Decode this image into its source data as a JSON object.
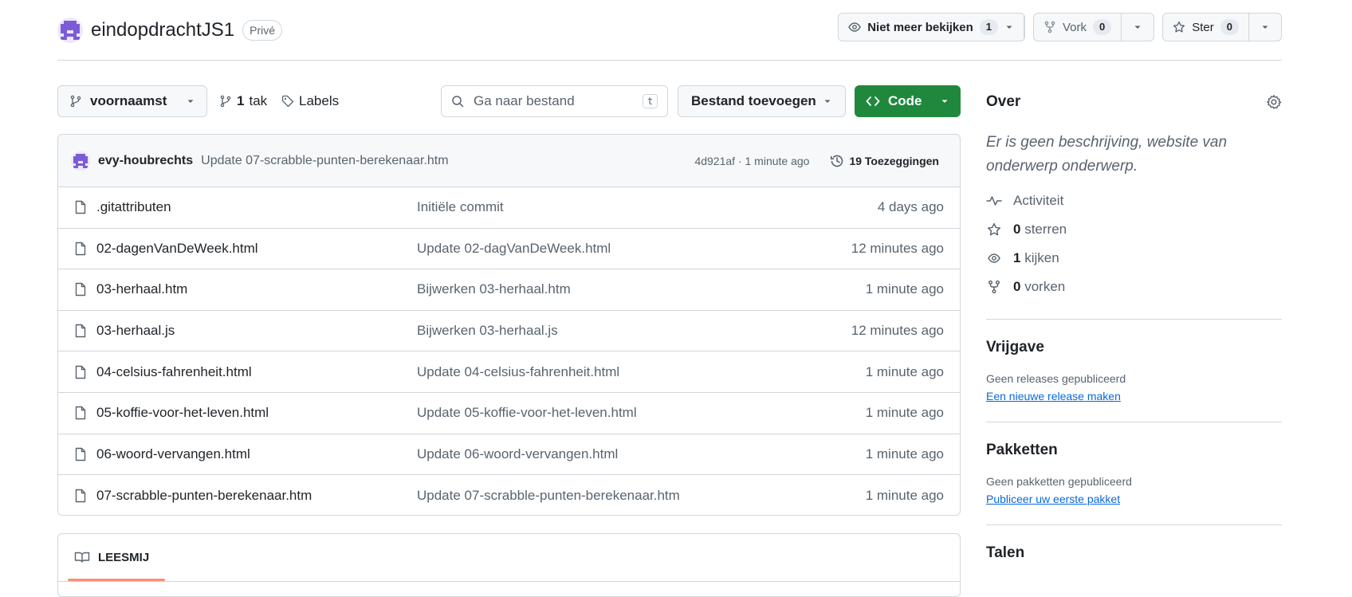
{
  "repo": {
    "name": "eindopdrachtJS1",
    "visibility": "Privé"
  },
  "header_actions": {
    "watch": {
      "label": "Niet meer bekijken",
      "count": "1"
    },
    "fork": {
      "label": "Vork",
      "count": "0"
    },
    "star": {
      "label": "Ster",
      "count": "0"
    }
  },
  "toolbar": {
    "branch": "voornaamst",
    "branches_count": "1",
    "branches_label": "tak",
    "tags_label": "Labels",
    "search_placeholder": "Ga naar bestand",
    "search_shortcut": "t",
    "add_file_label": "Bestand toevoegen",
    "code_label": "Code"
  },
  "latest_commit": {
    "author": "evy-houbrechts",
    "message": "Update 07-scrabble-punten-berekenaar.htm",
    "hash_time": "4d921af · 1 minute ago",
    "commits_label": "19 Toezeggingen"
  },
  "files": [
    {
      "name": ".gitattributen",
      "message": "Initiële commit",
      "age": "4 days ago"
    },
    {
      "name": "02-dagenVanDeWeek.html",
      "message": "Update 02-dagVanDeWeek.html",
      "age": "12 minutes ago"
    },
    {
      "name": "03-herhaal.htm",
      "message": "Bijwerken 03-herhaal.htm",
      "age": "1 minute ago"
    },
    {
      "name": "03-herhaal.js",
      "message": "Bijwerken 03-herhaal.js",
      "age": "12 minutes ago"
    },
    {
      "name": "04-celsius-fahrenheit.html",
      "message": "Update 04-celsius-fahrenheit.html",
      "age": "1 minute ago"
    },
    {
      "name": "05-koffie-voor-het-leven.html",
      "message": "Update 05-koffie-voor-het-leven.html",
      "age": "1 minute ago"
    },
    {
      "name": "06-woord-vervangen.html",
      "message": "Update 06-woord-vervangen.html",
      "age": "1 minute ago"
    },
    {
      "name": "07-scrabble-punten-berekenaar.htm",
      "message": "Update 07-scrabble-punten-berekenaar.htm",
      "age": "1 minute ago"
    }
  ],
  "readme": {
    "tab_label": "LEESMIJ"
  },
  "sidebar": {
    "about_title": "Over",
    "about_description": "Er is geen beschrijving, website van onderwerp onderwerp.",
    "activity_label": "Activiteit",
    "stars_count": "0",
    "stars_label": "sterren",
    "watchers_count": "1",
    "watchers_label": "kijken",
    "forks_count": "0",
    "forks_label": "vorken",
    "releases_title": "Vrijgave",
    "releases_empty": "Geen releases gepubliceerd",
    "releases_link": "Een nieuwe release maken",
    "packages_title": "Pakketten",
    "packages_empty": "Geen pakketten gepubliceerd",
    "packages_link": "Publiceer uw eerste pakket",
    "languages_title": "Talen"
  },
  "colors": {
    "accent_green": "#1f883d",
    "link_blue": "#0969da",
    "tab_underline": "#fd8c73"
  }
}
